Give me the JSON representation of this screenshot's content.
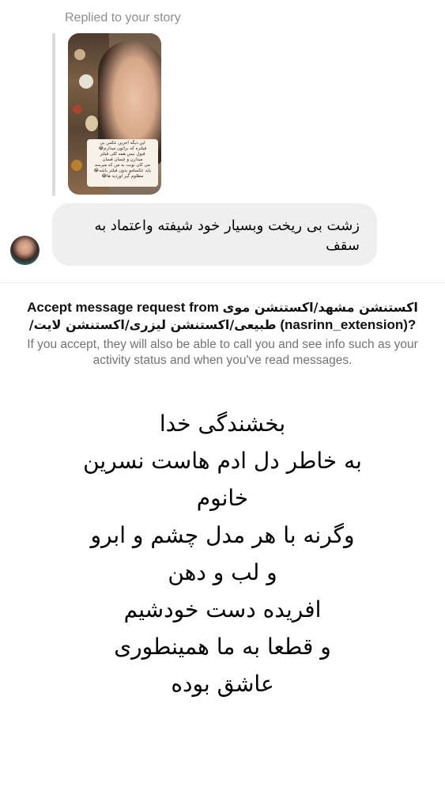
{
  "reply": {
    "label": "Replied to your story"
  },
  "story": {
    "caption_lines": [
      "این دیگه اخرین عکس بی",
      "فیلتره که براتون میذارم😂",
      "قبول نیس همه کلی فیلتر",
      "میذارن و چسان فسان",
      "می کان نوبت به من که میرسه",
      "باید عکسامو بدون فیلتر باشه😂",
      "مظلوم گیر اوردید ها😂"
    ]
  },
  "message": {
    "text": "زشت  بی ریخت  وبسیار خود شیفته واعتماد به سقف"
  },
  "request": {
    "title_prefix": "Accept message request from",
    "title_name": "اکستنشن مشهد/اکستنشن موی طبیعی/اکستنشن لیزری/اکستنشن لایت/",
    "title_username": "(nasrinn_extension)?",
    "subtitle": "If you accept, they will also be able to call you and see info such as your activity status and when you've read messages."
  },
  "overlay": {
    "lines": [
      "بخشندگی خدا",
      "به خاطر دل ادم هاست نسرین",
      "خانوم",
      "وگرنه با هر مدل چشم و ابرو",
      "و لب و دهن",
      "افریده دست خودشیم",
      "و قطعا به ما همینطوری",
      "عاشق بوده"
    ]
  }
}
